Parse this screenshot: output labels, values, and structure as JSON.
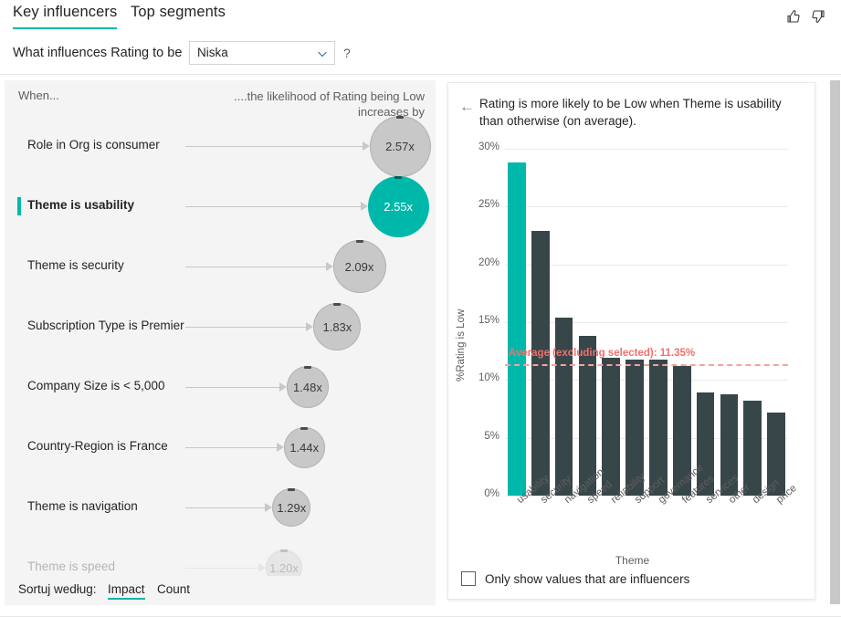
{
  "tabs": [
    {
      "label": "Key influencers",
      "active": true
    },
    {
      "label": "Top segments",
      "active": false
    }
  ],
  "header": {
    "thumbs_up_icon": "thumbs-up-icon",
    "thumbs_down_icon": "thumbs-down-icon"
  },
  "question": {
    "label": "What influences Rating to be",
    "dropdown_value": "Niska",
    "help": "?"
  },
  "left_panel": {
    "when_header": "When...",
    "likelihood_header": "....the likelihood of Rating being Low increases by",
    "influencers": [
      {
        "label": "Role in Org is consumer",
        "value": "2.57x",
        "selected": false,
        "faded": false
      },
      {
        "label": "Theme is usability",
        "value": "2.55x",
        "selected": true,
        "faded": false
      },
      {
        "label": "Theme is security",
        "value": "2.09x",
        "selected": false,
        "faded": false
      },
      {
        "label": "Subscription Type is Premier",
        "value": "1.83x",
        "selected": false,
        "faded": false
      },
      {
        "label": "Company Size is < 5,000",
        "value": "1.48x",
        "selected": false,
        "faded": false
      },
      {
        "label": "Country-Region is France",
        "value": "1.44x",
        "selected": false,
        "faded": false
      },
      {
        "label": "Theme is navigation",
        "value": "1.29x",
        "selected": false,
        "faded": false
      },
      {
        "label": "Theme is speed",
        "value": "1.20x",
        "selected": false,
        "faded": true
      }
    ],
    "sort": {
      "label": "Sortuj według:",
      "options": [
        {
          "label": "Impact",
          "active": true
        },
        {
          "label": "Count",
          "active": false
        }
      ]
    }
  },
  "right_panel": {
    "back_icon": "back-arrow-icon",
    "title": "Rating is more likely to be Low when Theme is usability than otherwise (on average).",
    "checkbox": {
      "label": "Only show values that are influencers",
      "checked": false
    }
  },
  "chart_data": {
    "type": "bar",
    "title": "",
    "xlabel": "Theme",
    "ylabel": "%Rating is Low",
    "categories": [
      "usability",
      "security",
      "navigation",
      "speed",
      "reliability",
      "support",
      "governance",
      "features",
      "services",
      "other",
      "design",
      "price"
    ],
    "values": [
      28.8,
      22.9,
      15.4,
      13.8,
      11.9,
      11.8,
      11.8,
      11.2,
      8.9,
      8.8,
      8.2,
      7.2
    ],
    "highlight_index": 0,
    "ylim": [
      0,
      30
    ],
    "ytick_labels": [
      "30%",
      "25%",
      "20%",
      "15%",
      "10%",
      "5%",
      "0%"
    ],
    "ytick_values": [
      30,
      25,
      20,
      15,
      10,
      5,
      0
    ],
    "grid": true,
    "legend": "none",
    "annotation": {
      "text": "Average (excluding selected): 11.35%",
      "value": 11.35
    },
    "colors": {
      "highlight": "#00B8AA",
      "bar": "#374649",
      "average_line": "#F8A19B"
    }
  }
}
